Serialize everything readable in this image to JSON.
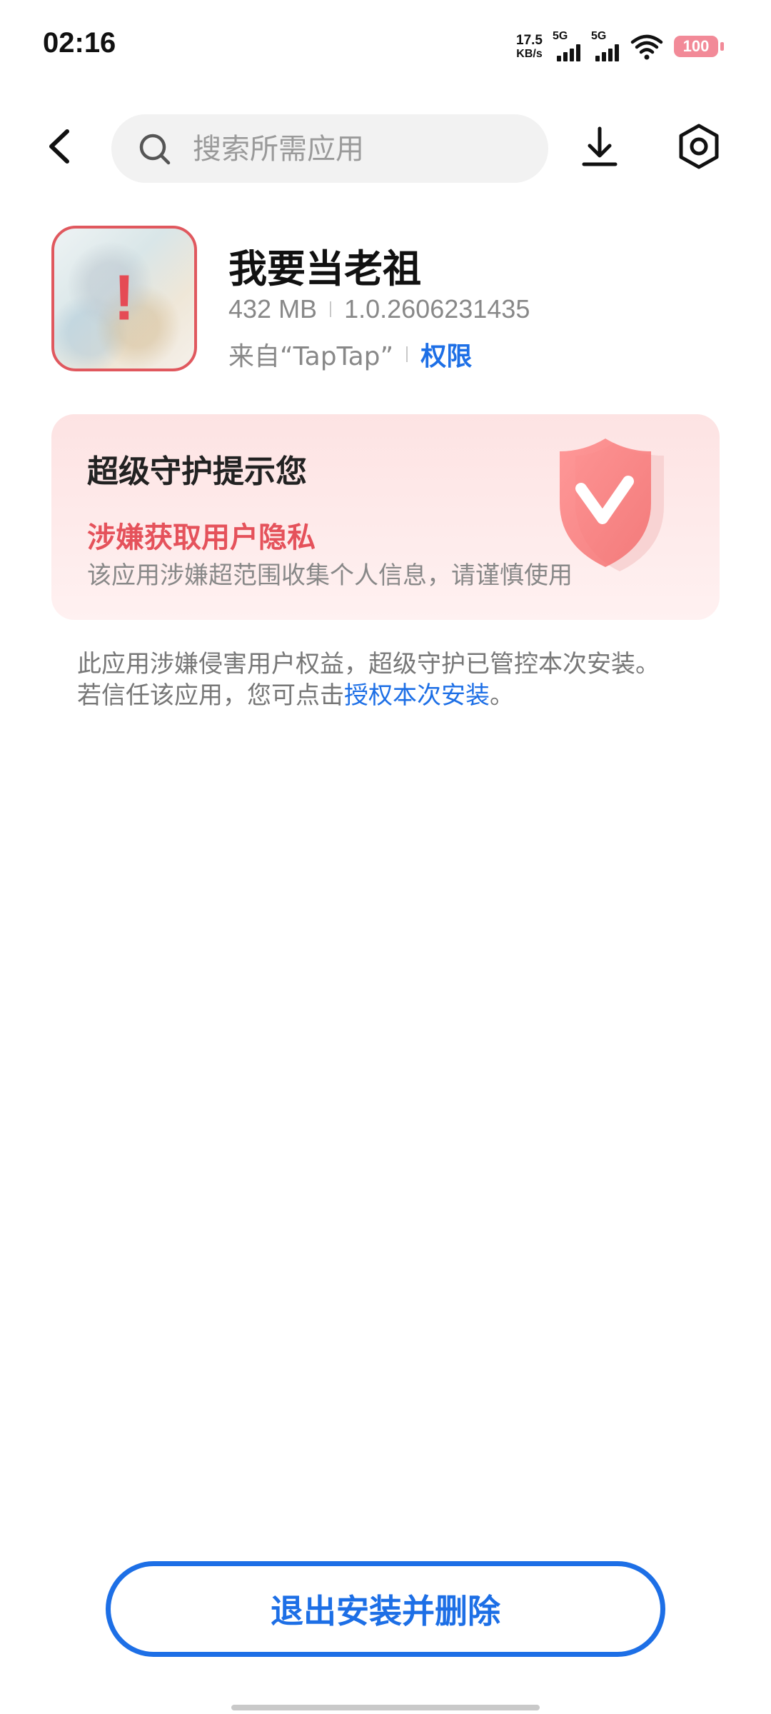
{
  "status_bar": {
    "time": "02:16",
    "net_speed_value": "17.5",
    "net_speed_unit": "KB/s",
    "sim1_label": "5G",
    "sim2_label": "5G",
    "battery": "100",
    "battery_color": "#f28a98"
  },
  "top_bar": {
    "back_icon": "chevron-left-icon",
    "search_placeholder": "搜索所需应用",
    "search_icon": "search-icon",
    "download_icon": "download-icon",
    "settings_icon": "settings-hexagon-icon"
  },
  "app": {
    "name": "我要当老祖",
    "size": "432 MB",
    "version": "1.0.2606231435",
    "source": "来自“TapTap”",
    "permissions_link": "权限",
    "icon_overlay": "!"
  },
  "warning": {
    "title": "超级守护提示您",
    "risk": "涉嫌获取用户隐私",
    "description": "该应用涉嫌超范围收集个人信息，请谨慎使用",
    "shield_icon": "shield-check-icon"
  },
  "note": {
    "line1": "此应用涉嫌侵害用户权益，超级守护已管控本次安装。",
    "line2_prefix": "若信任该应用，您可点击",
    "line2_link": "授权本次安装",
    "line2_suffix": "。"
  },
  "bottom": {
    "exit_button": "退出安装并删除"
  },
  "colors": {
    "accent": "#1d6fe6",
    "danger": "#e5525b",
    "card_bg": "#fde3e3"
  }
}
